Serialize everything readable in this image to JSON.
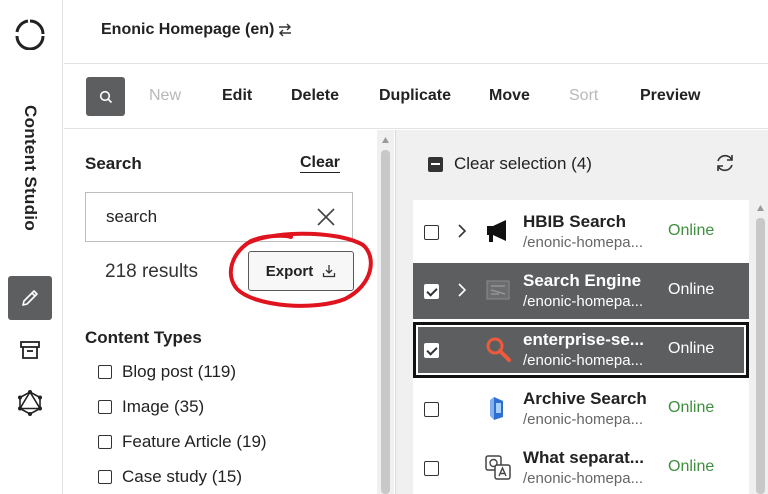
{
  "rail": {
    "app_label": "Content Studio",
    "buttons": [
      {
        "icon": "pencil-icon",
        "active": true
      },
      {
        "icon": "archive-icon",
        "active": false
      },
      {
        "icon": "graphql-icon",
        "active": false
      }
    ]
  },
  "header": {
    "project_name": "Enonic Homepage (en)"
  },
  "toolbar": {
    "new_label": "New",
    "edit_label": "Edit",
    "delete_label": "Delete",
    "duplicate_label": "Duplicate",
    "move_label": "Move",
    "sort_label": "Sort",
    "preview_label": "Preview"
  },
  "filter": {
    "title": "Search",
    "clear_label": "Clear",
    "search_value": "search",
    "results_count": "218 results",
    "export_label": "Export",
    "content_types_title": "Content Types",
    "content_types": [
      {
        "label": "Blog post (119)"
      },
      {
        "label": "Image (35)"
      },
      {
        "label": "Feature Article (19)"
      },
      {
        "label": "Case study (15)"
      }
    ]
  },
  "grid": {
    "clear_selection_label": "Clear selection (4)",
    "rows": [
      {
        "name": "HBIB Search",
        "path": "/enonic-homepa...",
        "status": "Online",
        "selected": false,
        "icon": "megaphone-icon"
      },
      {
        "name": "Search Engine",
        "path": "/enonic-homepa...",
        "status": "Online",
        "selected": true,
        "icon": "image-thumbnail-icon"
      },
      {
        "name": "enterprise-se...",
        "path": "/enonic-homepa...",
        "status": "Online",
        "selected": true,
        "icon": "magnifier-icon"
      },
      {
        "name": "Archive Search",
        "path": "/enonic-homepa...",
        "status": "Online",
        "selected": false,
        "icon": "archive-search-image-icon"
      },
      {
        "name": "What separat...",
        "path": "/enonic-homepa...",
        "status": "Online",
        "selected": false,
        "icon": "qa-icon"
      }
    ]
  },
  "colors": {
    "accent_dark": "#5c5e60",
    "online_green": "#3f8f3f",
    "annotation_red": "#e0141e"
  }
}
